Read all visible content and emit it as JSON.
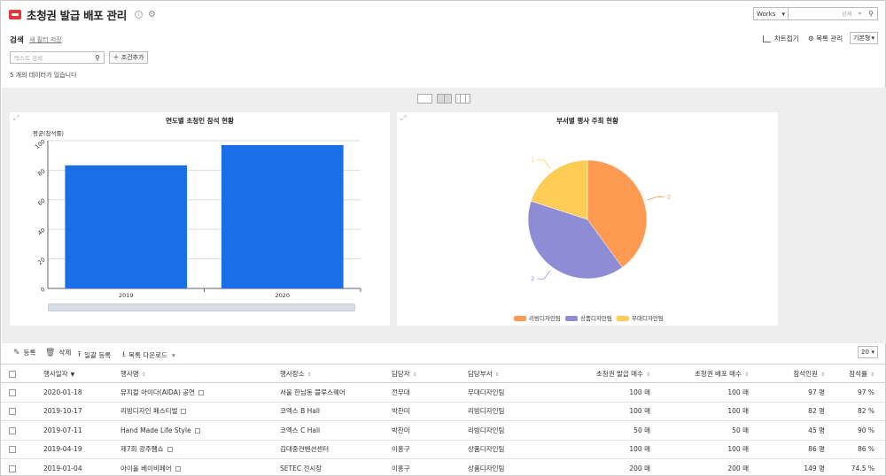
{
  "header": {
    "title": "초청권 발급 배포 관리",
    "app_select": "Works",
    "search_detail": "상세",
    "icons": {
      "logo": "red-ticket-icon",
      "info": "info-icon",
      "settings": "gear-icon",
      "search": "search-icon"
    }
  },
  "filter": {
    "label": "검색",
    "save_filter": "새 필터 저장",
    "search_placeholder": "텍스트 검색",
    "add_condition": "조건추가",
    "count_text": "5 개의 데이터가 있습니다"
  },
  "view_controls": {
    "chart_fold": "차트접기",
    "list_manage": "목록 관리",
    "view_type": "기본형"
  },
  "bar_chart": {
    "chart_data": {
      "type": "bar",
      "title": "연도별 초청인 참석 현황",
      "ylabel": "평균(참석률)",
      "categories": [
        "2019",
        "2020"
      ],
      "values": [
        83.3,
        97
      ],
      "ylim": [
        0,
        100
      ],
      "yticks": [
        0,
        20,
        40,
        60,
        80,
        100
      ],
      "color": "#1a6ee6",
      "grid": true
    }
  },
  "pie_chart": {
    "chart_data": {
      "type": "pie",
      "title": "부서별 행사 주최 현황",
      "slices": [
        {
          "name": "리빙디자인팀",
          "value": 2,
          "color": "#ff9a52"
        },
        {
          "name": "상품디자인팀",
          "value": 2,
          "color": "#8f8cd6"
        },
        {
          "name": "무대디자인팀",
          "value": 1,
          "color": "#ffcd55"
        }
      ],
      "legend": "bottom"
    }
  },
  "toolbar": {
    "register": "등록",
    "delete": "삭제",
    "bulk_register": "일괄 등록",
    "download": "목록 다운로드",
    "page_size": "20"
  },
  "table": {
    "columns": [
      "행사일자",
      "행사명",
      "행사장소",
      "담당자",
      "담당부서",
      "초청권 발급 매수",
      "초청권 배포 매수",
      "참석인원",
      "참석률"
    ],
    "rows": [
      {
        "date": "2020-01-18",
        "name": "뮤지컬 아이다(AIDA) 공연",
        "place": "서울 한남동 블루스퀘어",
        "manager": "전무대",
        "dept": "무대디자인팀",
        "issued": "100 매",
        "distributed": "100 매",
        "attendees": "97 명",
        "rate": "97 %"
      },
      {
        "date": "2019-10-17",
        "name": "리빙디자인 페스티벌",
        "place": "코엑스 B Hall",
        "manager": "박찬미",
        "dept": "리빙디자인팀",
        "issued": "100 매",
        "distributed": "100 매",
        "attendees": "82 명",
        "rate": "82 %"
      },
      {
        "date": "2019-07-11",
        "name": "Hand Made Life Style",
        "place": "코엑스 C Hall",
        "manager": "박찬미",
        "dept": "리빙디자인팀",
        "issued": "50 매",
        "distributed": "50 매",
        "attendees": "45 명",
        "rate": "90 %"
      },
      {
        "date": "2019-04-19",
        "name": "제7회 광주쨈쇼",
        "place": "김대중컨벤션센터",
        "manager": "이홍구",
        "dept": "상품디자인팀",
        "issued": "100 매",
        "distributed": "100 매",
        "attendees": "86 명",
        "rate": "86 %"
      },
      {
        "date": "2019-01-04",
        "name": "아이올 베이비페어",
        "place": "SETEC 전시장",
        "manager": "이홍구",
        "dept": "상품디자인팀",
        "issued": "200 매",
        "distributed": "200 매",
        "attendees": "149 명",
        "rate": "74.5 %"
      }
    ]
  }
}
